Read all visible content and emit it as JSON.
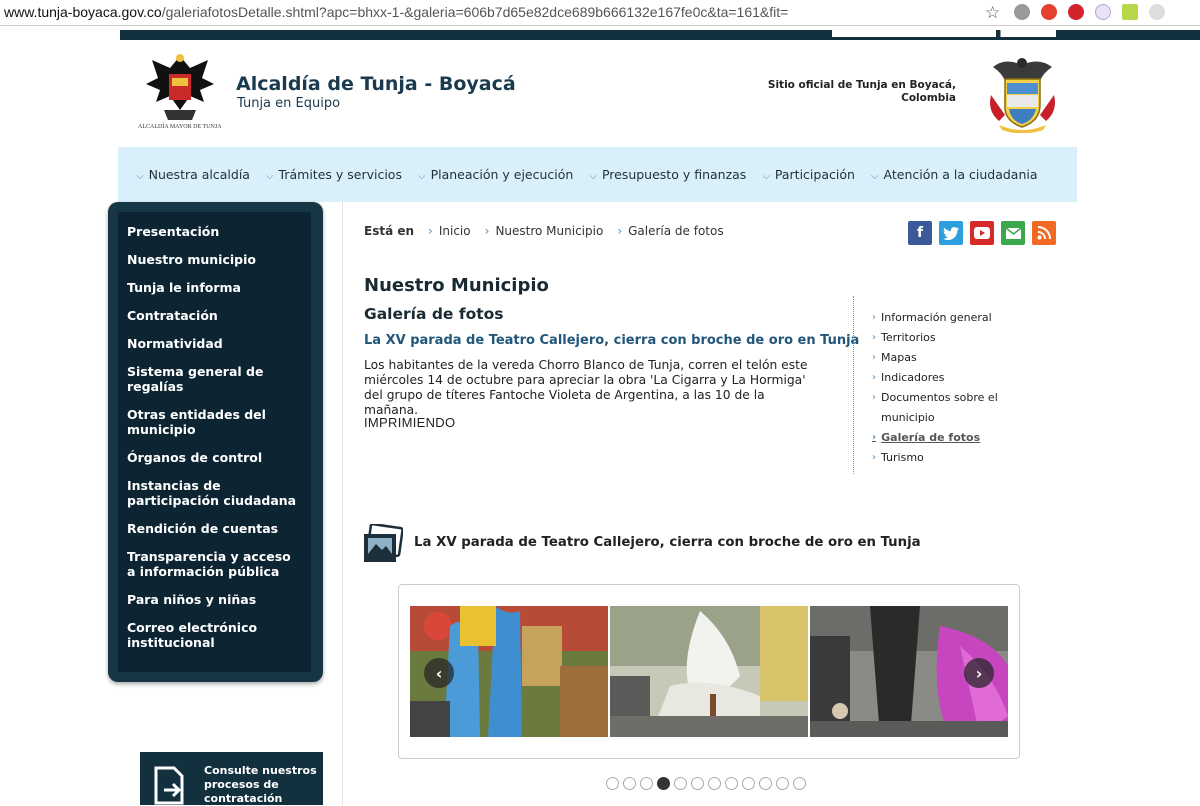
{
  "browser": {
    "url_host": "www.tunja-boyaca.gov.co",
    "url_path": "/galeriafotosDetalle.shtml?apc=bhxx-1-&galeria=606b7d65e82dce689b666132e167fe0c&ta=161&fit="
  },
  "header": {
    "crest_caption": "ALCALDÍA MAYOR DE TUNJA",
    "title": "Alcaldía de Tunja - Boyacá",
    "subtitle": "Tunja en Equipo",
    "official_line1": "Sitio oficial de Tunja en Boyacá,",
    "official_line2": "Colombia"
  },
  "topnav": [
    "Nuestra alcaldía",
    "Trámites y servicios",
    "Planeación y ejecución",
    "Presupuesto y finanzas",
    "Participación",
    "Atención a la ciudadania"
  ],
  "sidebar": [
    "Presentación",
    "Nuestro municipio",
    "Tunja le informa",
    "Contratación",
    "Normatividad",
    "Sistema general de regalías",
    "Otras entidades del municipio",
    "Órganos de control",
    "Instancias de participación ciudadana",
    "Rendición de cuentas",
    "Transparencia y acceso a información pública",
    "Para niños y niñas",
    "Correo electrónico institucional"
  ],
  "consult": {
    "line1": "Consulte nuestros",
    "line2": "procesos de",
    "line3": "contratación"
  },
  "breadcrumb": {
    "lead": "Está en",
    "items": [
      "Inicio",
      "Nuestro Municipio",
      "Galería de fotos"
    ]
  },
  "main": {
    "heading": "Nuestro Municipio",
    "subheading": "Galería de fotos",
    "article_title": "La XV parada de Teatro Callejero, cierra con broche de oro en Tunja",
    "article_body": "Los habitantes de la vereda Chorro Blanco de Tunja, corren el telón este miércoles 14 de octubre para apreciar la obra 'La Cigarra y La Hormiga' del grupo de títeres Fantoche Violeta de Argentina, a las 10 de la mañana.",
    "imprimiendo": "IMPRIMIENDO"
  },
  "subnav": [
    "Información general",
    "Territorios",
    "Mapas",
    "Indicadores",
    "Documentos sobre el municipio",
    "Galería de fotos",
    "Turismo"
  ],
  "subnav_active_index": 5,
  "gallery": {
    "title": "La XV parada de Teatro Callejero, cierra con broche de oro en Tunja",
    "prev": "‹",
    "next": "›",
    "dot_count": 12,
    "active_dot": 3
  },
  "colors": {
    "sidebar_bg": "#0d2533",
    "nav_bg": "#d9f0fb",
    "link_blue": "#22567a",
    "accent_chevron": "#4c8fc0"
  }
}
